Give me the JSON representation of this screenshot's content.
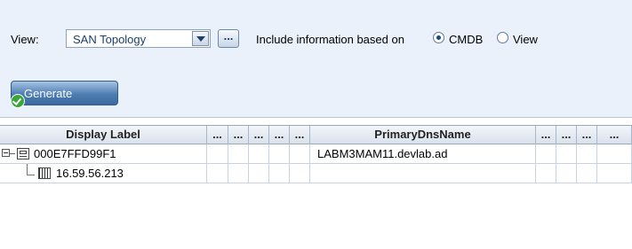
{
  "toolbar": {
    "view_label": "View:",
    "view_select_value": "SAN Topology",
    "browse_label": "...",
    "include_label": "Include information based on",
    "radio_cmdb_label": "CMDB",
    "radio_view_label": "View",
    "radio_selected": "CMDB",
    "generate_label": "Generate"
  },
  "table": {
    "headers": [
      "Display Label",
      "...",
      "...",
      "...",
      "...",
      "...",
      "PrimaryDnsName",
      "...",
      "...",
      "...",
      "..."
    ],
    "rows": [
      {
        "display_label": "000E7FFD99F1",
        "primary_dns_name": "LABM3MAM11.devlab.ad",
        "icon": "host-icon",
        "expanded": true
      },
      {
        "display_label": "16.59.56.213",
        "primary_dns_name": "",
        "icon": "ip-address-icon"
      }
    ]
  },
  "colors": {
    "toolbar_bg": "#eaf1fa",
    "button_blue": "#4e7db2",
    "check_green": "#3aa53a"
  }
}
